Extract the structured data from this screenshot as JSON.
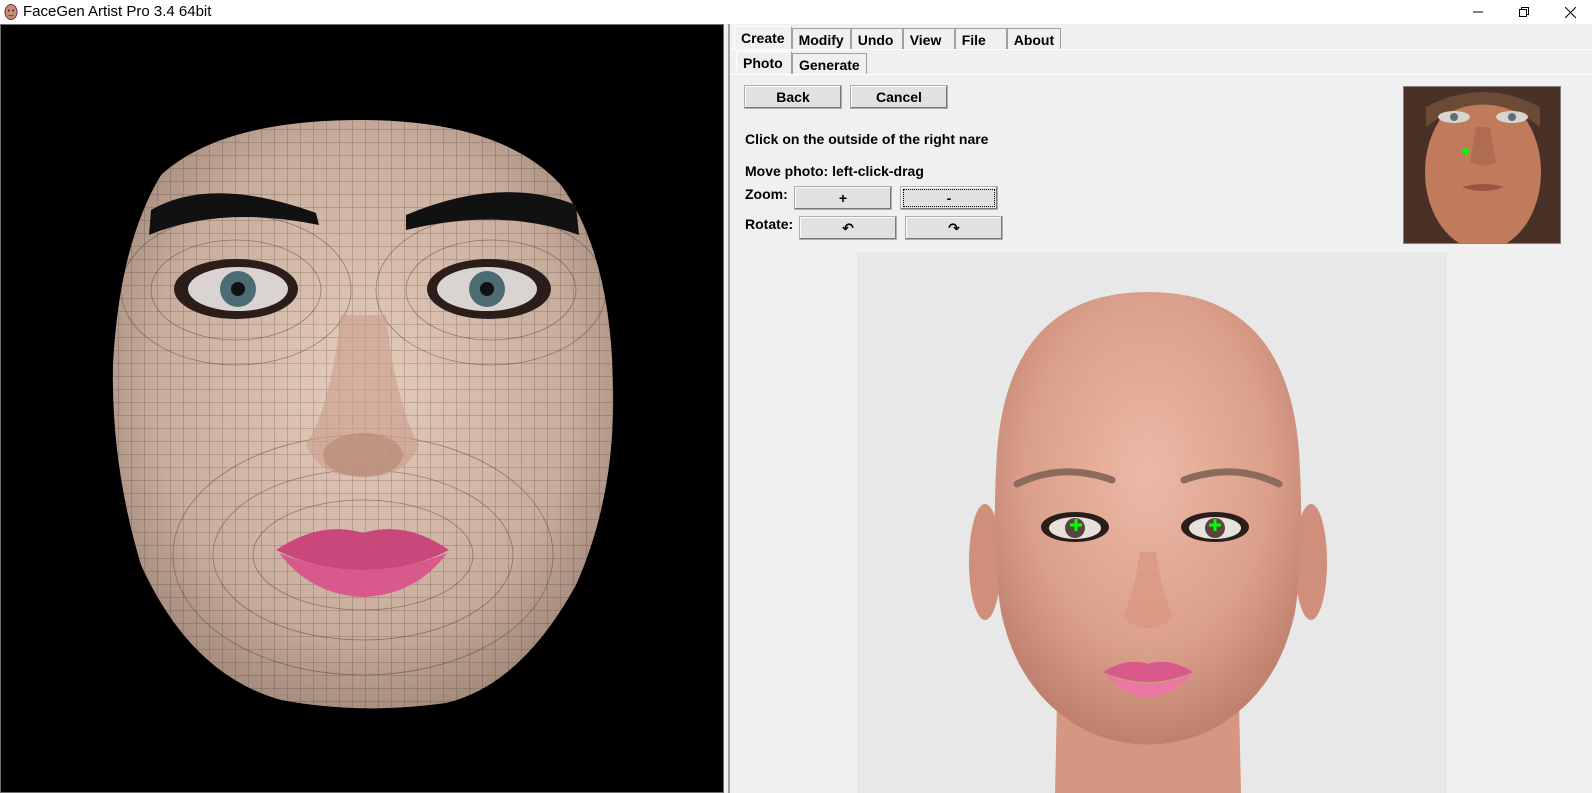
{
  "window": {
    "title": "FaceGen Artist Pro 3.4 64bit",
    "minimize_icon": "minimize-icon",
    "maximize_icon": "restore-icon",
    "close_icon": "close-icon"
  },
  "tabs": {
    "main": [
      {
        "label": "Create",
        "active": true
      },
      {
        "label": "Modify",
        "active": false
      },
      {
        "label": "Undo",
        "active": false
      },
      {
        "label": "View",
        "active": false
      },
      {
        "label": "File",
        "active": false
      },
      {
        "label": "About",
        "active": false
      }
    ],
    "sub": [
      {
        "label": "Photo",
        "active": true
      },
      {
        "label": "Generate",
        "active": false
      }
    ]
  },
  "controls": {
    "back_label": "Back",
    "cancel_label": "Cancel",
    "instruction": "Click on the outside of the right nare",
    "move_photo": "Move photo: left-click-drag",
    "zoom_label": "Zoom:",
    "zoom_in": "+",
    "zoom_out": "-",
    "rotate_label": "Rotate:",
    "rotate_ccw": "↶",
    "rotate_cw": "↷"
  },
  "colors": {
    "marker": "#00ff00",
    "viewport_bg": "#000000",
    "panel_bg": "#f0f0f0",
    "render_bg": "#e8e8e8"
  }
}
